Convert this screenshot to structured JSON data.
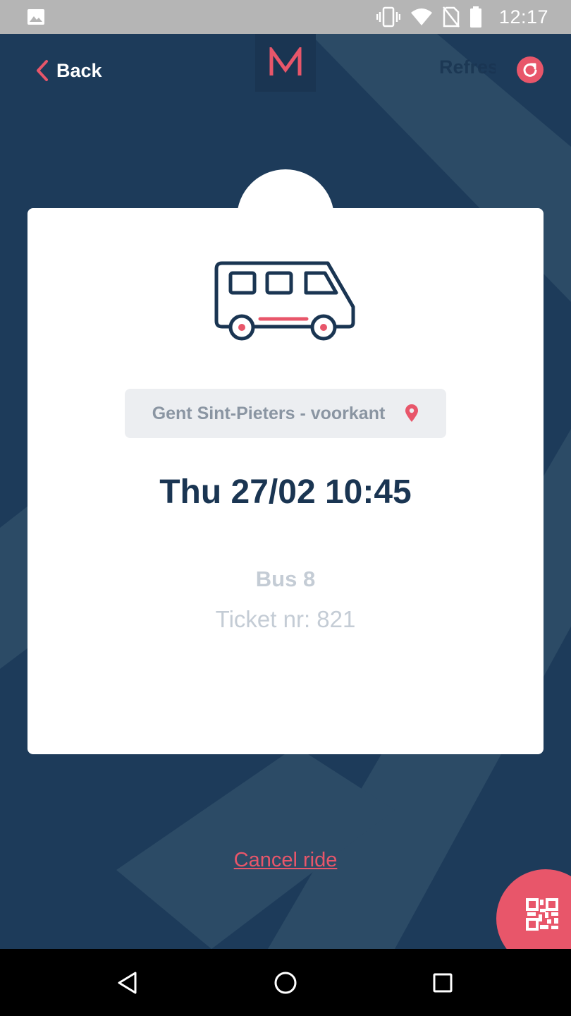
{
  "status_bar": {
    "time": "12:17",
    "icons": [
      "gallery-icon",
      "vibrate-icon",
      "wifi-icon",
      "no-sim-icon",
      "battery-icon"
    ]
  },
  "header": {
    "back_label": "Back",
    "logo_letter": "M",
    "refresh_label": "Refresh"
  },
  "ticket": {
    "vehicle_icon": "bus-icon",
    "location": "Gent Sint-Pieters - voorkant",
    "location_icon": "location-pin-icon",
    "datetime": "Thu 27/02 10:45",
    "bus_line": "Bus 8",
    "ticket_number": "Ticket nr: 821"
  },
  "actions": {
    "cancel_label": "Cancel ride",
    "qr_icon": "qr-code-icon"
  },
  "nav": {
    "buttons": [
      "back-triangle-icon",
      "home-circle-icon",
      "recents-square-icon"
    ]
  },
  "colors": {
    "primary_dark": "#1d3b5a",
    "accent": "#e8566a",
    "card": "#ffffff",
    "muted_text": "#c4ccd5"
  }
}
